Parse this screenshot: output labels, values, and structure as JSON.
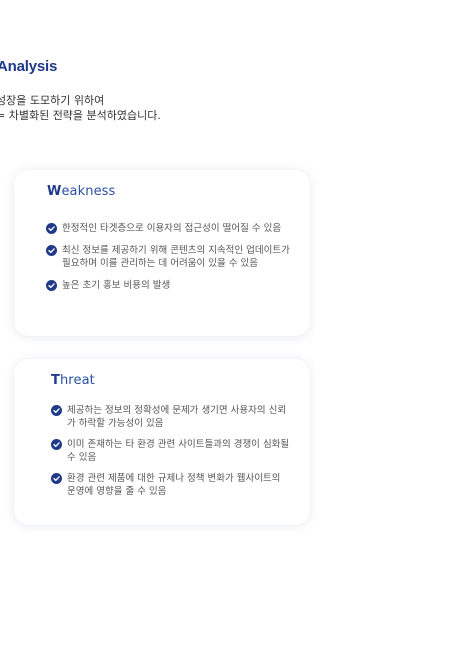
{
  "section": {
    "title": "Analysis",
    "intro_line1": "성장을 도모하기 위하여",
    "intro_line2": "= 차별화된 전략을 분석하였습니다."
  },
  "weakness": {
    "title_first": "W",
    "title_rest": "eakness",
    "items": [
      "한정적인 타겟층으로 이용자의 접근성이 떨어질 수 있음",
      "최신 정보를 제공하기 위해 콘텐츠의 지속적인 업데이트가 필요하며 이를 관리하는 데 어려움이 있을 수 있음",
      "높은 초기 홍보 비용의 발생"
    ]
  },
  "threat": {
    "title_first": "T",
    "title_rest": "hreat",
    "items": [
      "제공하는 정보의 정확성에 문제가 생기면 사용자의 신뢰가 하락할 가능성이 있음",
      "이미 존재하는 타 환경 관련 사이트들과의 경쟁이 심화될 수 있음",
      "환경 관련 제품에 대한 규제나 정책 변화가 웹사이트의 운영에 영향을 줄 수 있음"
    ]
  },
  "icons": {
    "bullet": "check-circle-icon"
  },
  "colors": {
    "accent": "#1f3a8a",
    "title_light": "#2b50a6",
    "text": "#555555"
  }
}
